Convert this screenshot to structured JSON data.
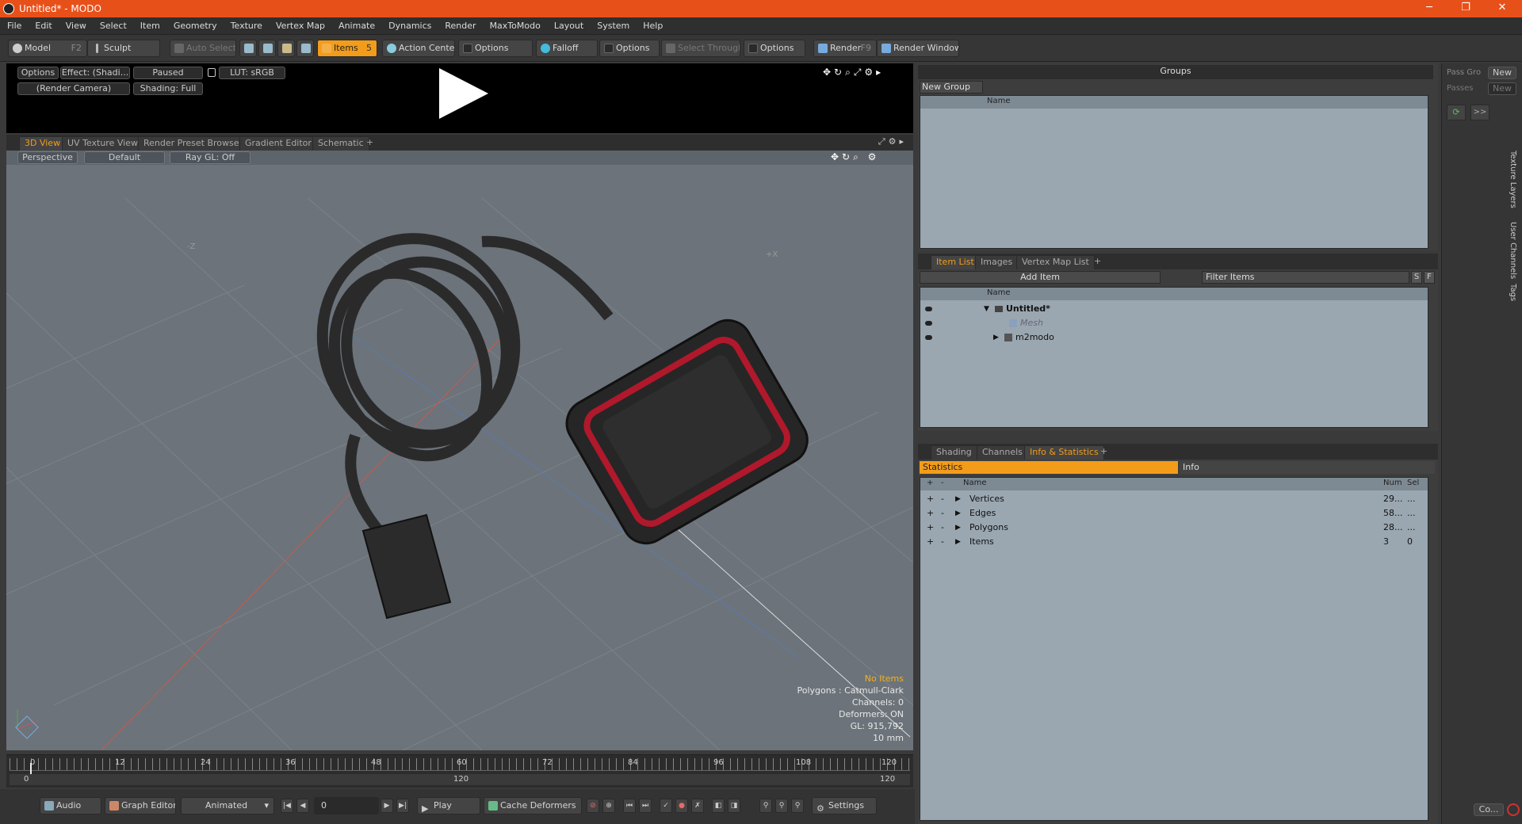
{
  "window": {
    "title": "Untitled* - MODO",
    "min": "─",
    "max": "❐",
    "close": "✕"
  },
  "menu": [
    "File",
    "Edit",
    "View",
    "Select",
    "Item",
    "Geometry",
    "Texture",
    "Vertex Map",
    "Animate",
    "Dynamics",
    "Render",
    "MaxToModo",
    "Layout",
    "System",
    "Help"
  ],
  "toolbar": {
    "model": "Model",
    "model_key": "F2",
    "sculpt": "Sculpt",
    "auto_select": "Auto Select",
    "items": "Items",
    "items_key": "5",
    "action_center": "Action Center",
    "options1": "Options",
    "falloff": "Falloff",
    "options2": "Options",
    "select_through": "Select Through",
    "options3": "Options",
    "render": "Render",
    "render_key": "F9",
    "render_window": "Render Window"
  },
  "preview": {
    "options": "Options",
    "effect": "Effect: (Shadi...",
    "paused": "Paused",
    "lut": "LUT: sRGB",
    "camera": "(Render Camera)",
    "shading": "Shading: Full"
  },
  "view_tabs": [
    "3D View",
    "UV Texture View",
    "Render Preset Browser",
    "Gradient Editor",
    "Schematic"
  ],
  "view_tabs_plus": "+",
  "viewport": {
    "perspective": "Perspective",
    "default": "Default",
    "raygl": "Ray GL: Off",
    "axis_z": "-Z",
    "axis_x": "+X",
    "info": {
      "no_items": "No Items",
      "polygons": "Polygons : Catmull-Clark",
      "channels": "Channels: 0",
      "deformers": "Deformers: ON",
      "gl": "GL: 915,792",
      "unit": "10 mm"
    }
  },
  "timeline": {
    "top_ticks": [
      "0",
      "12",
      "24",
      "36",
      "48",
      "60",
      "72",
      "84",
      "96",
      "108",
      "120"
    ],
    "bottom_ticks": [
      "0",
      "120",
      "120"
    ]
  },
  "bottombar": {
    "audio": "Audio",
    "graph_editor": "Graph Editor",
    "animated": "Animated",
    "frame": "0",
    "play": "Play",
    "cache": "Cache Deformers",
    "settings": "Settings"
  },
  "groups": {
    "title": "Groups",
    "new_group": "New Group",
    "name_col": "Name"
  },
  "item_list": {
    "tabs": [
      "Item List",
      "Images",
      "Vertex Map List"
    ],
    "plus": "+",
    "add_item": "Add Item",
    "filter": "Filter Items",
    "s": "S",
    "f": "F",
    "name_col": "Name",
    "rows": [
      {
        "label": "Untitled*"
      },
      {
        "label": "Mesh"
      },
      {
        "label": "m2modo"
      }
    ]
  },
  "info_stats": {
    "tabs": [
      "Shading",
      "Channels",
      "Info & Statistics"
    ],
    "plus": "+",
    "statistics": "Statistics",
    "info": "Info",
    "cols": {
      "name": "Name",
      "num": "Num",
      "sel": "Sel"
    },
    "rows": [
      {
        "name": "Vertices",
        "num": "29...",
        "sel": "..."
      },
      {
        "name": "Edges",
        "num": "58...",
        "sel": "..."
      },
      {
        "name": "Polygons",
        "num": "28...",
        "sel": "..."
      },
      {
        "name": "Items",
        "num": "3",
        "sel": "0"
      }
    ]
  },
  "far_right": {
    "pass_group": "Pass Gro",
    "new1": "New",
    "passes": "Passes",
    "new2": "New",
    "vtabs": [
      "Texture Layers",
      "User Channels",
      "Tags"
    ],
    "co": "Co..."
  }
}
